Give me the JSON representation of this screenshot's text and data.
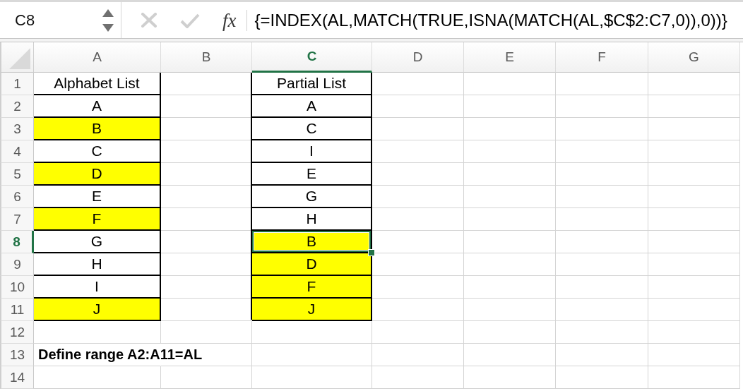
{
  "formula_bar": {
    "name_box": "C8",
    "function_label": "fx",
    "formula": "{=INDEX(AL,MATCH(TRUE,ISNA(MATCH(AL,$C$2:C7,0)),0))}"
  },
  "columns": [
    {
      "label": "A",
      "selected": false
    },
    {
      "label": "B",
      "selected": false
    },
    {
      "label": "C",
      "selected": true
    },
    {
      "label": "D",
      "selected": false
    },
    {
      "label": "E",
      "selected": false
    },
    {
      "label": "F",
      "selected": false
    },
    {
      "label": "G",
      "selected": false
    }
  ],
  "rows": [
    {
      "number": "1",
      "selected": false,
      "cells": [
        {
          "kind": "value",
          "text": "Alphabet List",
          "highlighted": false,
          "bordered": true,
          "selected": false
        },
        {
          "kind": "empty",
          "highlighted": false,
          "bordered": false,
          "selected": false
        },
        {
          "kind": "value",
          "text": "Partial List",
          "highlighted": false,
          "bordered": true,
          "selected": false
        },
        {
          "kind": "empty",
          "highlighted": false,
          "bordered": false,
          "selected": false
        },
        {
          "kind": "empty",
          "highlighted": false,
          "bordered": false,
          "selected": false
        },
        {
          "kind": "empty",
          "highlighted": false,
          "bordered": false,
          "selected": false
        },
        {
          "kind": "empty",
          "highlighted": false,
          "bordered": false,
          "selected": false
        }
      ]
    },
    {
      "number": "2",
      "selected": false,
      "cells": [
        {
          "kind": "value",
          "text": "A",
          "highlighted": false,
          "bordered": true,
          "selected": false
        },
        {
          "kind": "empty",
          "highlighted": false,
          "bordered": false,
          "selected": false
        },
        {
          "kind": "value",
          "text": "A",
          "highlighted": false,
          "bordered": true,
          "selected": false
        },
        {
          "kind": "empty",
          "highlighted": false,
          "bordered": false,
          "selected": false
        },
        {
          "kind": "empty",
          "highlighted": false,
          "bordered": false,
          "selected": false
        },
        {
          "kind": "empty",
          "highlighted": false,
          "bordered": false,
          "selected": false
        },
        {
          "kind": "empty",
          "highlighted": false,
          "bordered": false,
          "selected": false
        }
      ]
    },
    {
      "number": "3",
      "selected": false,
      "cells": [
        {
          "kind": "value",
          "text": "B",
          "highlighted": true,
          "bordered": true,
          "selected": false
        },
        {
          "kind": "empty",
          "highlighted": false,
          "bordered": false,
          "selected": false
        },
        {
          "kind": "value",
          "text": "C",
          "highlighted": false,
          "bordered": true,
          "selected": false
        },
        {
          "kind": "empty",
          "highlighted": false,
          "bordered": false,
          "selected": false
        },
        {
          "kind": "empty",
          "highlighted": false,
          "bordered": false,
          "selected": false
        },
        {
          "kind": "empty",
          "highlighted": false,
          "bordered": false,
          "selected": false
        },
        {
          "kind": "empty",
          "highlighted": false,
          "bordered": false,
          "selected": false
        }
      ]
    },
    {
      "number": "4",
      "selected": false,
      "cells": [
        {
          "kind": "value",
          "text": "C",
          "highlighted": false,
          "bordered": true,
          "selected": false
        },
        {
          "kind": "empty",
          "highlighted": false,
          "bordered": false,
          "selected": false
        },
        {
          "kind": "value",
          "text": "I",
          "highlighted": false,
          "bordered": true,
          "selected": false
        },
        {
          "kind": "empty",
          "highlighted": false,
          "bordered": false,
          "selected": false
        },
        {
          "kind": "empty",
          "highlighted": false,
          "bordered": false,
          "selected": false
        },
        {
          "kind": "empty",
          "highlighted": false,
          "bordered": false,
          "selected": false
        },
        {
          "kind": "empty",
          "highlighted": false,
          "bordered": false,
          "selected": false
        }
      ]
    },
    {
      "number": "5",
      "selected": false,
      "cells": [
        {
          "kind": "value",
          "text": "D",
          "highlighted": true,
          "bordered": true,
          "selected": false
        },
        {
          "kind": "empty",
          "highlighted": false,
          "bordered": false,
          "selected": false
        },
        {
          "kind": "value",
          "text": "E",
          "highlighted": false,
          "bordered": true,
          "selected": false
        },
        {
          "kind": "empty",
          "highlighted": false,
          "bordered": false,
          "selected": false
        },
        {
          "kind": "empty",
          "highlighted": false,
          "bordered": false,
          "selected": false
        },
        {
          "kind": "empty",
          "highlighted": false,
          "bordered": false,
          "selected": false
        },
        {
          "kind": "empty",
          "highlighted": false,
          "bordered": false,
          "selected": false
        }
      ]
    },
    {
      "number": "6",
      "selected": false,
      "cells": [
        {
          "kind": "value",
          "text": "E",
          "highlighted": false,
          "bordered": true,
          "selected": false
        },
        {
          "kind": "empty",
          "highlighted": false,
          "bordered": false,
          "selected": false
        },
        {
          "kind": "value",
          "text": "G",
          "highlighted": false,
          "bordered": true,
          "selected": false
        },
        {
          "kind": "empty",
          "highlighted": false,
          "bordered": false,
          "selected": false
        },
        {
          "kind": "empty",
          "highlighted": false,
          "bordered": false,
          "selected": false
        },
        {
          "kind": "empty",
          "highlighted": false,
          "bordered": false,
          "selected": false
        },
        {
          "kind": "empty",
          "highlighted": false,
          "bordered": false,
          "selected": false
        }
      ]
    },
    {
      "number": "7",
      "selected": false,
      "cells": [
        {
          "kind": "value",
          "text": "F",
          "highlighted": true,
          "bordered": true,
          "selected": false
        },
        {
          "kind": "empty",
          "highlighted": false,
          "bordered": false,
          "selected": false
        },
        {
          "kind": "value",
          "text": "H",
          "highlighted": false,
          "bordered": true,
          "selected": false
        },
        {
          "kind": "empty",
          "highlighted": false,
          "bordered": false,
          "selected": false
        },
        {
          "kind": "empty",
          "highlighted": false,
          "bordered": false,
          "selected": false
        },
        {
          "kind": "empty",
          "highlighted": false,
          "bordered": false,
          "selected": false
        },
        {
          "kind": "empty",
          "highlighted": false,
          "bordered": false,
          "selected": false
        }
      ]
    },
    {
      "number": "8",
      "selected": true,
      "cells": [
        {
          "kind": "value",
          "text": "G",
          "highlighted": false,
          "bordered": true,
          "selected": false
        },
        {
          "kind": "empty",
          "highlighted": false,
          "bordered": false,
          "selected": false
        },
        {
          "kind": "value",
          "text": "B",
          "highlighted": true,
          "bordered": true,
          "selected": true
        },
        {
          "kind": "empty",
          "highlighted": false,
          "bordered": false,
          "selected": false
        },
        {
          "kind": "empty",
          "highlighted": false,
          "bordered": false,
          "selected": false
        },
        {
          "kind": "empty",
          "highlighted": false,
          "bordered": false,
          "selected": false
        },
        {
          "kind": "empty",
          "highlighted": false,
          "bordered": false,
          "selected": false
        }
      ]
    },
    {
      "number": "9",
      "selected": false,
      "cells": [
        {
          "kind": "value",
          "text": "H",
          "highlighted": false,
          "bordered": true,
          "selected": false
        },
        {
          "kind": "empty",
          "highlighted": false,
          "bordered": false,
          "selected": false
        },
        {
          "kind": "value",
          "text": "D",
          "highlighted": true,
          "bordered": true,
          "selected": false
        },
        {
          "kind": "empty",
          "highlighted": false,
          "bordered": false,
          "selected": false
        },
        {
          "kind": "empty",
          "highlighted": false,
          "bordered": false,
          "selected": false
        },
        {
          "kind": "empty",
          "highlighted": false,
          "bordered": false,
          "selected": false
        },
        {
          "kind": "empty",
          "highlighted": false,
          "bordered": false,
          "selected": false
        }
      ]
    },
    {
      "number": "10",
      "selected": false,
      "cells": [
        {
          "kind": "value",
          "text": "I",
          "highlighted": false,
          "bordered": true,
          "selected": false
        },
        {
          "kind": "empty",
          "highlighted": false,
          "bordered": false,
          "selected": false
        },
        {
          "kind": "value",
          "text": "F",
          "highlighted": true,
          "bordered": true,
          "selected": false
        },
        {
          "kind": "empty",
          "highlighted": false,
          "bordered": false,
          "selected": false
        },
        {
          "kind": "empty",
          "highlighted": false,
          "bordered": false,
          "selected": false
        },
        {
          "kind": "empty",
          "highlighted": false,
          "bordered": false,
          "selected": false
        },
        {
          "kind": "empty",
          "highlighted": false,
          "bordered": false,
          "selected": false
        }
      ]
    },
    {
      "number": "11",
      "selected": false,
      "cells": [
        {
          "kind": "value",
          "text": "J",
          "highlighted": true,
          "bordered": true,
          "selected": false
        },
        {
          "kind": "empty",
          "highlighted": false,
          "bordered": false,
          "selected": false
        },
        {
          "kind": "value",
          "text": "J",
          "highlighted": true,
          "bordered": true,
          "selected": false
        },
        {
          "kind": "empty",
          "highlighted": false,
          "bordered": false,
          "selected": false
        },
        {
          "kind": "empty",
          "highlighted": false,
          "bordered": false,
          "selected": false
        },
        {
          "kind": "empty",
          "highlighted": false,
          "bordered": false,
          "selected": false
        },
        {
          "kind": "empty",
          "highlighted": false,
          "bordered": false,
          "selected": false
        }
      ]
    },
    {
      "number": "12",
      "selected": false,
      "cells": [
        {
          "kind": "empty",
          "highlighted": false,
          "bordered": false,
          "selected": false
        },
        {
          "kind": "empty",
          "highlighted": false,
          "bordered": false,
          "selected": false
        },
        {
          "kind": "empty",
          "highlighted": false,
          "bordered": false,
          "selected": false
        },
        {
          "kind": "empty",
          "highlighted": false,
          "bordered": false,
          "selected": false
        },
        {
          "kind": "empty",
          "highlighted": false,
          "bordered": false,
          "selected": false
        },
        {
          "kind": "empty",
          "highlighted": false,
          "bordered": false,
          "selected": false
        },
        {
          "kind": "empty",
          "highlighted": false,
          "bordered": false,
          "selected": false
        }
      ]
    },
    {
      "number": "13",
      "selected": false,
      "cells": [
        {
          "kind": "note",
          "text": "Define range A2:A11=AL",
          "highlighted": false,
          "bordered": false,
          "selected": false
        },
        {
          "kind": "empty",
          "highlighted": false,
          "bordered": false,
          "selected": false
        },
        {
          "kind": "empty",
          "highlighted": false,
          "bordered": false,
          "selected": false
        },
        {
          "kind": "empty",
          "highlighted": false,
          "bordered": false,
          "selected": false
        },
        {
          "kind": "empty",
          "highlighted": false,
          "bordered": false,
          "selected": false
        },
        {
          "kind": "empty",
          "highlighted": false,
          "bordered": false,
          "selected": false
        },
        {
          "kind": "empty",
          "highlighted": false,
          "bordered": false,
          "selected": false
        }
      ]
    },
    {
      "number": "14",
      "selected": false,
      "cells": [
        {
          "kind": "empty",
          "highlighted": false,
          "bordered": false,
          "selected": false
        },
        {
          "kind": "empty",
          "highlighted": false,
          "bordered": false,
          "selected": false
        },
        {
          "kind": "empty",
          "highlighted": false,
          "bordered": false,
          "selected": false
        },
        {
          "kind": "empty",
          "highlighted": false,
          "bordered": false,
          "selected": false
        },
        {
          "kind": "empty",
          "highlighted": false,
          "bordered": false,
          "selected": false
        },
        {
          "kind": "empty",
          "highlighted": false,
          "bordered": false,
          "selected": false
        },
        {
          "kind": "empty",
          "highlighted": false,
          "bordered": false,
          "selected": false
        }
      ]
    }
  ]
}
